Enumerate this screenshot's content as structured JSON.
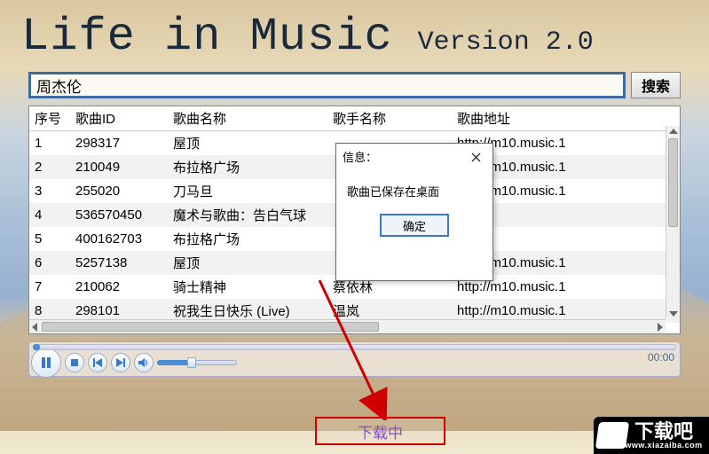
{
  "header": {
    "title": "Life in Music",
    "version": "Version 2.0"
  },
  "search": {
    "value": "周杰伦",
    "button": "搜索"
  },
  "columns": {
    "c0": "序号",
    "c1": "歌曲ID",
    "c2": "歌曲名称",
    "c3": "歌手名称",
    "c4": "歌曲地址"
  },
  "rows": [
    {
      "n": "1",
      "id": "298317",
      "name": "屋顶",
      "artist": "",
      "url": "http://m10.music.1"
    },
    {
      "n": "2",
      "id": "210049",
      "name": "布拉格广场",
      "artist": "",
      "url": "http://m10.music.1"
    },
    {
      "n": "3",
      "id": "255020",
      "name": "刀马旦",
      "artist": "",
      "url": "http://m10.music.1"
    },
    {
      "n": "4",
      "id": "536570450",
      "name": "魔术与歌曲：告白气球",
      "artist": "",
      "url": "null"
    },
    {
      "n": "5",
      "id": "400162703",
      "name": "布拉格广场",
      "artist": "",
      "url": "null"
    },
    {
      "n": "6",
      "id": "5257138",
      "name": "屋顶",
      "artist": "",
      "url": "http://m10.music.1"
    },
    {
      "n": "7",
      "id": "210062",
      "name": "骑士精神",
      "artist": "蔡依林",
      "url": "http://m10.music.1"
    },
    {
      "n": "8",
      "id": "298101",
      "name": "祝我生日快乐 (Live)",
      "artist": "温岚",
      "url": "http://m10.music.1"
    }
  ],
  "player": {
    "session": "00:00"
  },
  "dialog": {
    "title": "信息：",
    "message": "歌曲已保存在桌面",
    "ok": "确定"
  },
  "download": {
    "label": "下载中"
  },
  "watermark": {
    "cn": "下载吧",
    "en": "www.xiazaiba.com"
  }
}
